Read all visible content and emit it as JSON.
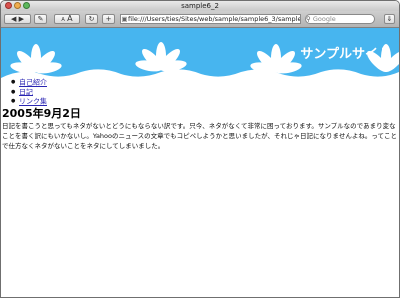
{
  "window": {
    "title": "sample6_2"
  },
  "toolbar": {
    "back_icon": "back-arrow-icon",
    "forward_icon": "forward-arrow-icon",
    "text_smaller_label": "A",
    "text_larger_label": "A",
    "reload_icon": "reload-icon",
    "add_bookmark_label": "+",
    "address": "file:///Users/ties/Sites/web/sample/sample6_3/sample",
    "search_placeholder": "Google"
  },
  "page": {
    "site_title": "サンプルサイト",
    "banner_color": "#47b5ef",
    "nav": [
      {
        "label": "自己紹介"
      },
      {
        "label": "日記"
      },
      {
        "label": "リンク集"
      }
    ],
    "date": "2005年9月2日",
    "body": "日記を書こうと思ってもネタがないとどうにもならない訳です。只今、ネタがなくて非常に困っております。サンプルなのであまり変なことを書く訳にもいかないし。Yahooのニュースの文章でもコピペしようかと思いましたが、それじゃ日記になりませんよね。ってことで仕方なくネタがないことをネタにしてしまいました。"
  }
}
